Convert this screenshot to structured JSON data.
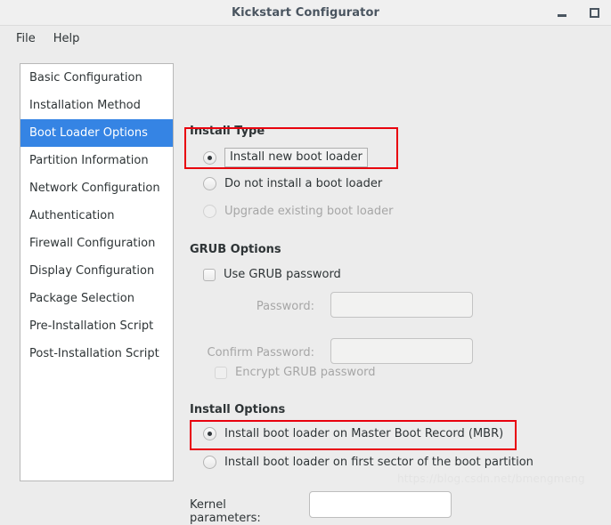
{
  "window": {
    "title": "Kickstart Configurator",
    "controls": [
      {
        "name": "minimize-button",
        "icon": "minimize-icon",
        "label": "_"
      },
      {
        "name": "maximize-button",
        "icon": "maximize-icon",
        "label": "□"
      }
    ]
  },
  "menubar": {
    "items": [
      {
        "label": "File"
      },
      {
        "label": "Help"
      }
    ]
  },
  "sidebar": {
    "selected_index": 2,
    "items": [
      {
        "label": "Basic Configuration"
      },
      {
        "label": "Installation Method"
      },
      {
        "label": "Boot Loader Options"
      },
      {
        "label": "Partition Information"
      },
      {
        "label": "Network Configuration"
      },
      {
        "label": "Authentication"
      },
      {
        "label": "Firewall Configuration"
      },
      {
        "label": "Display Configuration"
      },
      {
        "label": "Package Selection"
      },
      {
        "label": "Pre-Installation Script"
      },
      {
        "label": "Post-Installation Script"
      }
    ]
  },
  "panel": {
    "install_type": {
      "title": "Install Type",
      "options": [
        {
          "label": "Install new boot loader",
          "checked": true,
          "disabled": false,
          "focused": true
        },
        {
          "label": "Do not install a boot loader",
          "checked": false,
          "disabled": false,
          "focused": false
        },
        {
          "label": "Upgrade existing boot loader",
          "checked": false,
          "disabled": true,
          "focused": false
        }
      ]
    },
    "grub_options": {
      "title": "GRUB Options",
      "use_grub_password": {
        "label": "Use GRUB password",
        "checked": false,
        "disabled": false
      },
      "password": {
        "label": "Password:",
        "value": "",
        "disabled": true
      },
      "confirm_password": {
        "label": "Confirm Password:",
        "value": "",
        "disabled": true
      },
      "encrypt_grub_password": {
        "label": "Encrypt GRUB password",
        "checked": false,
        "disabled": true
      }
    },
    "install_options": {
      "title": "Install Options",
      "options": [
        {
          "label": "Install boot loader on Master Boot Record (MBR)",
          "checked": true,
          "disabled": false
        },
        {
          "label": "Install boot loader on first sector of the boot partition",
          "checked": false,
          "disabled": false
        }
      ],
      "kernel_parameters": {
        "label": "Kernel parameters:",
        "value": "",
        "disabled": false
      }
    }
  },
  "annotations": [
    {
      "name": "highlight-install-type",
      "color": "#e8000d"
    },
    {
      "name": "highlight-mbr-option",
      "color": "#e8000d"
    }
  ],
  "watermark": {
    "text": "https://blog.csdn.net/bmengmeng"
  }
}
